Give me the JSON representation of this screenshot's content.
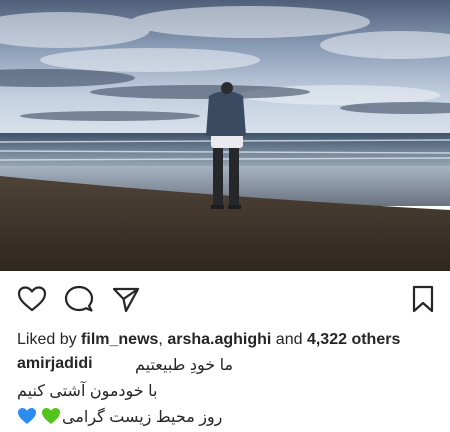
{
  "post": {
    "photo": {
      "sky_top": "#5d6f8c",
      "sky_mid": "#b9c6d8",
      "sea": "#5b6f86",
      "sand": "#3c342c"
    }
  },
  "actions": {
    "like_icon": "heart-outline-icon",
    "comment_icon": "comment-bubble-icon",
    "share_icon": "paper-plane-icon",
    "save_icon": "bookmark-icon"
  },
  "likes": {
    "prefix": "Liked by",
    "user1": "film_news",
    "separator": ",",
    "user2": "arsha.aghighi",
    "and": "and",
    "others": "4,322 others"
  },
  "caption": {
    "username": "amirjadidi",
    "line1": "ما خودِ طبیعتیم",
    "line2": "با خودمون آشتی کنیم",
    "line3": "روز محیط زیست گرامی",
    "emoji1": "blue-heart-icon",
    "emoji2": "green-heart-icon",
    "emoji1_color": "#2d8cf0",
    "emoji2_color": "#52c41a"
  }
}
